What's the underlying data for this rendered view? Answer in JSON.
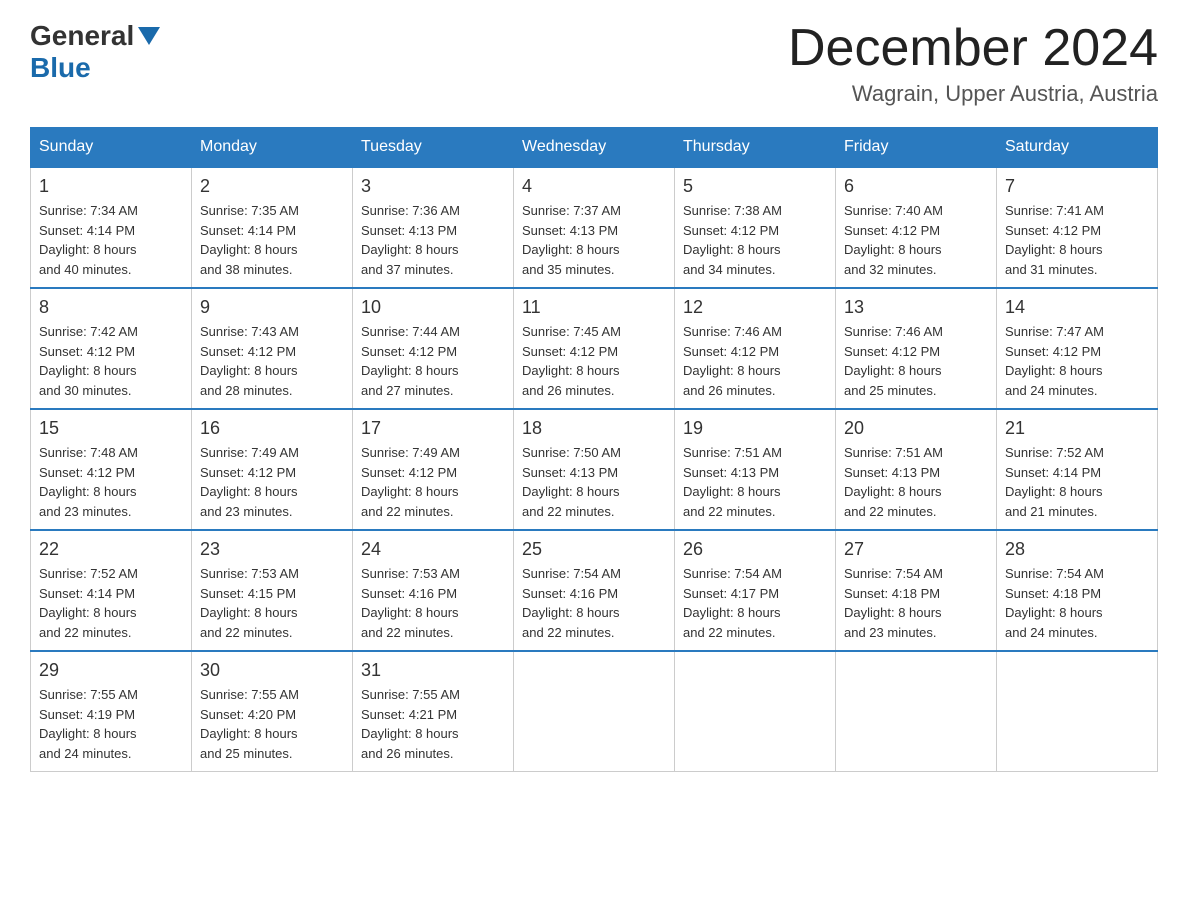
{
  "header": {
    "logo": {
      "general": "General",
      "blue": "Blue"
    },
    "title": "December 2024",
    "location": "Wagrain, Upper Austria, Austria"
  },
  "weekdays": [
    "Sunday",
    "Monday",
    "Tuesday",
    "Wednesday",
    "Thursday",
    "Friday",
    "Saturday"
  ],
  "weeks": [
    [
      {
        "day": "1",
        "sunrise": "7:34 AM",
        "sunset": "4:14 PM",
        "daylight": "8 hours and 40 minutes."
      },
      {
        "day": "2",
        "sunrise": "7:35 AM",
        "sunset": "4:14 PM",
        "daylight": "8 hours and 38 minutes."
      },
      {
        "day": "3",
        "sunrise": "7:36 AM",
        "sunset": "4:13 PM",
        "daylight": "8 hours and 37 minutes."
      },
      {
        "day": "4",
        "sunrise": "7:37 AM",
        "sunset": "4:13 PM",
        "daylight": "8 hours and 35 minutes."
      },
      {
        "day": "5",
        "sunrise": "7:38 AM",
        "sunset": "4:12 PM",
        "daylight": "8 hours and 34 minutes."
      },
      {
        "day": "6",
        "sunrise": "7:40 AM",
        "sunset": "4:12 PM",
        "daylight": "8 hours and 32 minutes."
      },
      {
        "day": "7",
        "sunrise": "7:41 AM",
        "sunset": "4:12 PM",
        "daylight": "8 hours and 31 minutes."
      }
    ],
    [
      {
        "day": "8",
        "sunrise": "7:42 AM",
        "sunset": "4:12 PM",
        "daylight": "8 hours and 30 minutes."
      },
      {
        "day": "9",
        "sunrise": "7:43 AM",
        "sunset": "4:12 PM",
        "daylight": "8 hours and 28 minutes."
      },
      {
        "day": "10",
        "sunrise": "7:44 AM",
        "sunset": "4:12 PM",
        "daylight": "8 hours and 27 minutes."
      },
      {
        "day": "11",
        "sunrise": "7:45 AM",
        "sunset": "4:12 PM",
        "daylight": "8 hours and 26 minutes."
      },
      {
        "day": "12",
        "sunrise": "7:46 AM",
        "sunset": "4:12 PM",
        "daylight": "8 hours and 26 minutes."
      },
      {
        "day": "13",
        "sunrise": "7:46 AM",
        "sunset": "4:12 PM",
        "daylight": "8 hours and 25 minutes."
      },
      {
        "day": "14",
        "sunrise": "7:47 AM",
        "sunset": "4:12 PM",
        "daylight": "8 hours and 24 minutes."
      }
    ],
    [
      {
        "day": "15",
        "sunrise": "7:48 AM",
        "sunset": "4:12 PM",
        "daylight": "8 hours and 23 minutes."
      },
      {
        "day": "16",
        "sunrise": "7:49 AM",
        "sunset": "4:12 PM",
        "daylight": "8 hours and 23 minutes."
      },
      {
        "day": "17",
        "sunrise": "7:49 AM",
        "sunset": "4:12 PM",
        "daylight": "8 hours and 22 minutes."
      },
      {
        "day": "18",
        "sunrise": "7:50 AM",
        "sunset": "4:13 PM",
        "daylight": "8 hours and 22 minutes."
      },
      {
        "day": "19",
        "sunrise": "7:51 AM",
        "sunset": "4:13 PM",
        "daylight": "8 hours and 22 minutes."
      },
      {
        "day": "20",
        "sunrise": "7:51 AM",
        "sunset": "4:13 PM",
        "daylight": "8 hours and 22 minutes."
      },
      {
        "day": "21",
        "sunrise": "7:52 AM",
        "sunset": "4:14 PM",
        "daylight": "8 hours and 21 minutes."
      }
    ],
    [
      {
        "day": "22",
        "sunrise": "7:52 AM",
        "sunset": "4:14 PM",
        "daylight": "8 hours and 22 minutes."
      },
      {
        "day": "23",
        "sunrise": "7:53 AM",
        "sunset": "4:15 PM",
        "daylight": "8 hours and 22 minutes."
      },
      {
        "day": "24",
        "sunrise": "7:53 AM",
        "sunset": "4:16 PM",
        "daylight": "8 hours and 22 minutes."
      },
      {
        "day": "25",
        "sunrise": "7:54 AM",
        "sunset": "4:16 PM",
        "daylight": "8 hours and 22 minutes."
      },
      {
        "day": "26",
        "sunrise": "7:54 AM",
        "sunset": "4:17 PM",
        "daylight": "8 hours and 22 minutes."
      },
      {
        "day": "27",
        "sunrise": "7:54 AM",
        "sunset": "4:18 PM",
        "daylight": "8 hours and 23 minutes."
      },
      {
        "day": "28",
        "sunrise": "7:54 AM",
        "sunset": "4:18 PM",
        "daylight": "8 hours and 24 minutes."
      }
    ],
    [
      {
        "day": "29",
        "sunrise": "7:55 AM",
        "sunset": "4:19 PM",
        "daylight": "8 hours and 24 minutes."
      },
      {
        "day": "30",
        "sunrise": "7:55 AM",
        "sunset": "4:20 PM",
        "daylight": "8 hours and 25 minutes."
      },
      {
        "day": "31",
        "sunrise": "7:55 AM",
        "sunset": "4:21 PM",
        "daylight": "8 hours and 26 minutes."
      },
      null,
      null,
      null,
      null
    ]
  ],
  "labels": {
    "sunrise": "Sunrise:",
    "sunset": "Sunset:",
    "daylight": "Daylight:"
  }
}
